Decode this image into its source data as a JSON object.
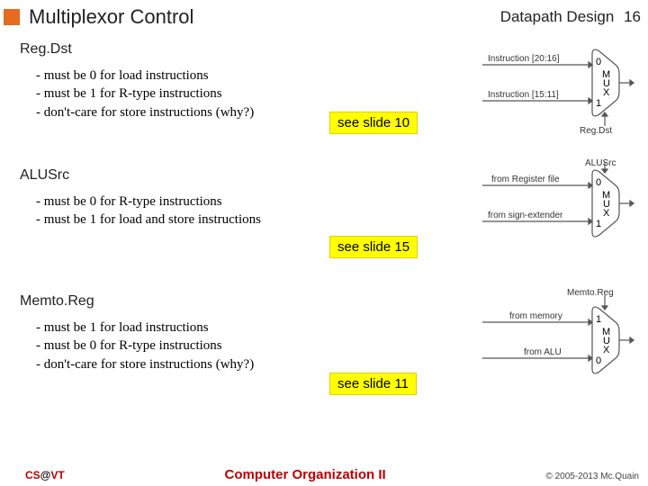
{
  "header": {
    "title": "Multiplexor Control",
    "chapter": "Datapath Design",
    "page": "16"
  },
  "sections": [
    {
      "title": "Reg.Dst",
      "bullets": [
        "must be 0 for load instructions",
        "must be 1 for R-type instructions",
        "don't-care for store instructions (why?)"
      ],
      "see": "see slide 10",
      "diagram": {
        "in0": "Instruction [20:16]",
        "in1": "Instruction [15:11]",
        "ctrl": "Reg.Dst",
        "p0": "0",
        "p1": "1",
        "m": "M",
        "u": "U",
        "x": "X"
      }
    },
    {
      "title": "ALUSrc",
      "bullets": [
        "must be 0 for R-type instructions",
        "must be 1 for load and store instructions"
      ],
      "see": "see slide 15",
      "diagram": {
        "in0": "from Register file",
        "in1": "from sign-extender",
        "ctrl": "ALUSrc",
        "p0": "0",
        "p1": "1",
        "m": "M",
        "u": "U",
        "x": "X"
      }
    },
    {
      "title": "Memto.Reg",
      "bullets": [
        "must be 1 for load instructions",
        "must be 0 for R-type instructions",
        "don't-care for store instructions (why?)"
      ],
      "see": "see slide 11",
      "diagram": {
        "in0": "from memory",
        "in1": "from ALU",
        "ctrl": "Memto.Reg",
        "p0": "1",
        "p1": "0",
        "m": "M",
        "u": "U",
        "x": "X",
        "ctrl_top": true
      }
    }
  ],
  "footer": {
    "left_cs": "CS",
    "left_at": "@",
    "left_vt": "VT",
    "center": "Computer Organization II",
    "right": "© 2005-2013 Mc.Quain"
  }
}
